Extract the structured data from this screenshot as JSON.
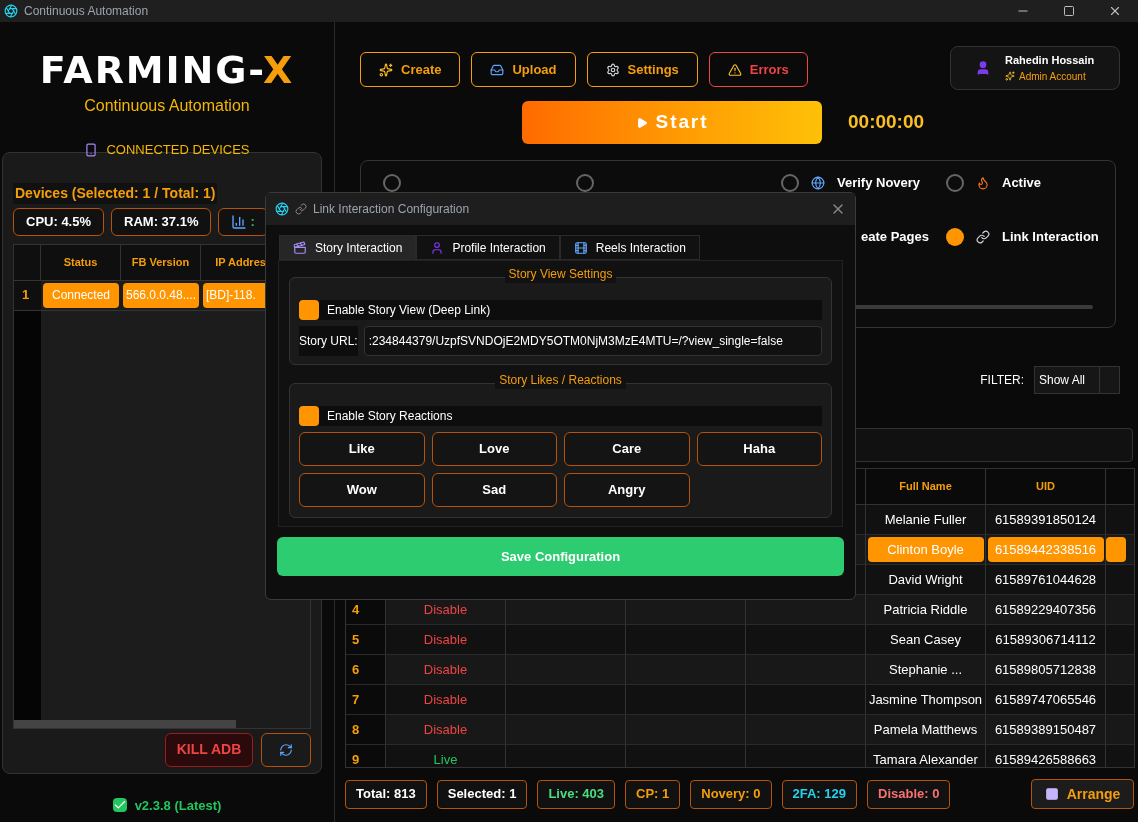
{
  "window": {
    "title": "Continuous Automation"
  },
  "logo": {
    "text": "FARMING-",
    "accent": "X",
    "subtitle": "Continuous Automation"
  },
  "devices_panel": {
    "heading": "CONNECTED DEVICES",
    "summary": "Devices (Selected: 1 / Total: 1)",
    "stats": [
      {
        "kind": "text",
        "label": "CPU: 4.5%"
      },
      {
        "kind": "text",
        "label": "RAM: 37.1%"
      },
      {
        "kind": "signal",
        "label": ":"
      }
    ],
    "columns": [
      "Status",
      "FB Version",
      "IP Addres"
    ],
    "rows": [
      {
        "index": "1",
        "cells": [
          "Connected",
          "566.0.0.48....",
          "[BD]-118."
        ]
      }
    ],
    "kill_button": "KILL ADB"
  },
  "version": "v2.3.8 (Latest)",
  "toolbar": [
    {
      "kind": "create",
      "label": "Create"
    },
    {
      "kind": "upload",
      "label": "Upload"
    },
    {
      "kind": "settings",
      "label": "Settings"
    },
    {
      "kind": "errors",
      "label": "Errors"
    }
  ],
  "user": {
    "name": "Rahedin Hossain",
    "role": "Admin Account"
  },
  "start_button": "Start",
  "timer": "00:00:00",
  "options": [
    {
      "kind": "blank",
      "selected": false
    },
    {
      "kind": "blank",
      "selected": false
    },
    {
      "kind": "globe",
      "label": "Verify Novery",
      "selected": false
    },
    {
      "kind": "flame",
      "label": "Active",
      "selected": false
    },
    {
      "kind": "partial",
      "label": "eate Pages"
    },
    {
      "kind": "link",
      "label": "Link Interaction",
      "selected": true
    }
  ],
  "filter": {
    "label": "FILTER:",
    "value": "Show All"
  },
  "table": {
    "columns": [
      "Full Name",
      "UID"
    ],
    "rows": [
      {
        "name": "Melanie Fuller",
        "uid": "61589391850124",
        "selected": false
      },
      {
        "name": "Clinton Boyle",
        "uid": "61589442338516",
        "selected": true
      },
      {
        "name": "David Wright",
        "uid": "61589761044628",
        "selected": false
      },
      {
        "index": "4",
        "status": "Disable",
        "kind": "disable",
        "name": "Patricia Riddle",
        "uid": "61589229407356",
        "selected": false
      },
      {
        "index": "5",
        "status": "Disable",
        "kind": "disable",
        "name": "Sean Casey",
        "uid": "61589306714112",
        "selected": false
      },
      {
        "index": "6",
        "status": "Disable",
        "kind": "disable",
        "name": "Stephanie ...",
        "uid": "61589805712838",
        "selected": false
      },
      {
        "index": "7",
        "status": "Disable",
        "kind": "disable",
        "name": "Jasmine Thompson",
        "uid": "61589747065546",
        "selected": false
      },
      {
        "index": "8",
        "status": "Disable",
        "kind": "disable",
        "name": "Pamela Matthews",
        "uid": "61589389150487",
        "selected": false
      },
      {
        "index": "9",
        "status": "Live",
        "kind": "live",
        "name": "Tamara Alexander",
        "uid": "61589426588663",
        "selected": false
      }
    ]
  },
  "counters": [
    {
      "label": "Total: 813",
      "color": "#ffffff"
    },
    {
      "label": "Selected: 1",
      "color": "#ffffff"
    },
    {
      "label": "Live: 403",
      "color": "#4ade80"
    },
    {
      "label": "CP: 1",
      "color": "#f59e0b"
    },
    {
      "label": "Novery: 0",
      "color": "#f59e0b"
    },
    {
      "label": "2FA: 129",
      "color": "#22d3ee"
    },
    {
      "label": "Disable: 0",
      "color": "#f87171"
    }
  ],
  "arrange_button": "Arrange",
  "dialog": {
    "title": "Link Interaction Configuration",
    "tabs": [
      {
        "kind": "story",
        "label": "Story Interaction",
        "selected": true
      },
      {
        "kind": "profile",
        "label": "Profile Interaction",
        "selected": false
      },
      {
        "kind": "reels",
        "label": "Reels Interaction",
        "selected": false
      }
    ],
    "view_section": {
      "title": "Story View Settings",
      "checkbox": {
        "label": "Enable Story View (Deep Link)",
        "checked": true
      },
      "url_label": "Story URL:",
      "url_value": ":234844379/UzpfSVNDOjE2MDY5OTM0NjM3MzE4MTU=/?view_single=false"
    },
    "reactions_section": {
      "title": "Story Likes / Reactions",
      "checkbox": {
        "label": "Enable Story Reactions",
        "checked": true
      },
      "reactions": [
        "Like",
        "Love",
        "Care",
        "Haha",
        "Wow",
        "Sad",
        "Angry"
      ]
    },
    "save_button": "Save Configuration"
  }
}
